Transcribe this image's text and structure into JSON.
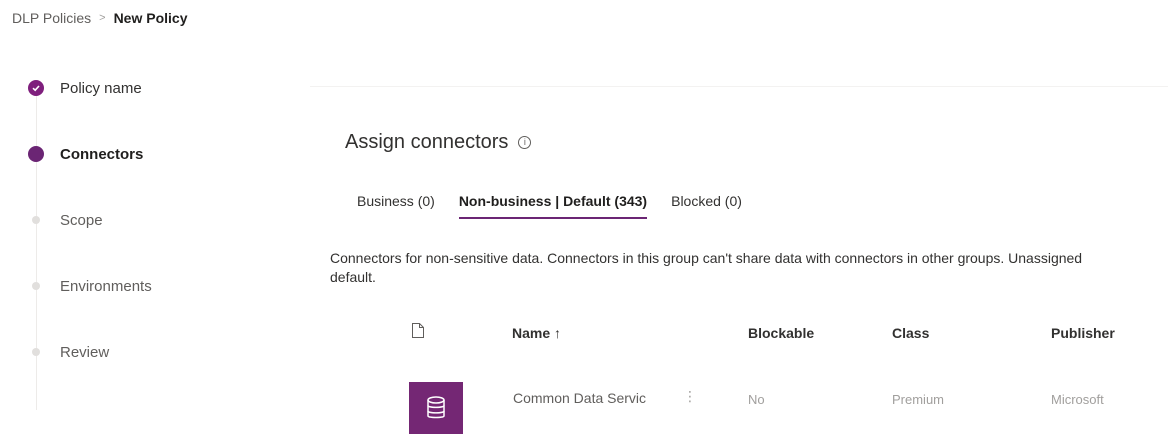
{
  "breadcrumb": {
    "parent": "DLP Policies",
    "separator": ">",
    "current": "New Policy"
  },
  "steps": [
    {
      "label": "Policy name",
      "state": "complete"
    },
    {
      "label": "Connectors",
      "state": "current"
    },
    {
      "label": "Scope",
      "state": "future"
    },
    {
      "label": "Environments",
      "state": "future"
    },
    {
      "label": "Review",
      "state": "future"
    }
  ],
  "section": {
    "title": "Assign connectors",
    "info_icon": "info-icon"
  },
  "tabs": [
    {
      "label": "Business (0)",
      "active": false
    },
    {
      "label": "Non-business | Default (343)",
      "active": true
    },
    {
      "label": "Blocked (0)",
      "active": false
    }
  ],
  "description": {
    "line1": "Connectors for non-sensitive data. Connectors in this group can't share data with connectors in other groups. Unassigned",
    "line2": "default."
  },
  "table": {
    "columns": {
      "icon": "file-icon",
      "name": "Name ↑",
      "blockable": "Blockable",
      "class": "Class",
      "publisher": "Publisher"
    },
    "rows": [
      {
        "icon": "database-icon",
        "name": "Common Data Servic",
        "blockable": "No",
        "class": "Premium",
        "publisher": "Microsoft"
      }
    ]
  },
  "colors": {
    "accent": "#742774",
    "current_step": "#6b2574"
  }
}
